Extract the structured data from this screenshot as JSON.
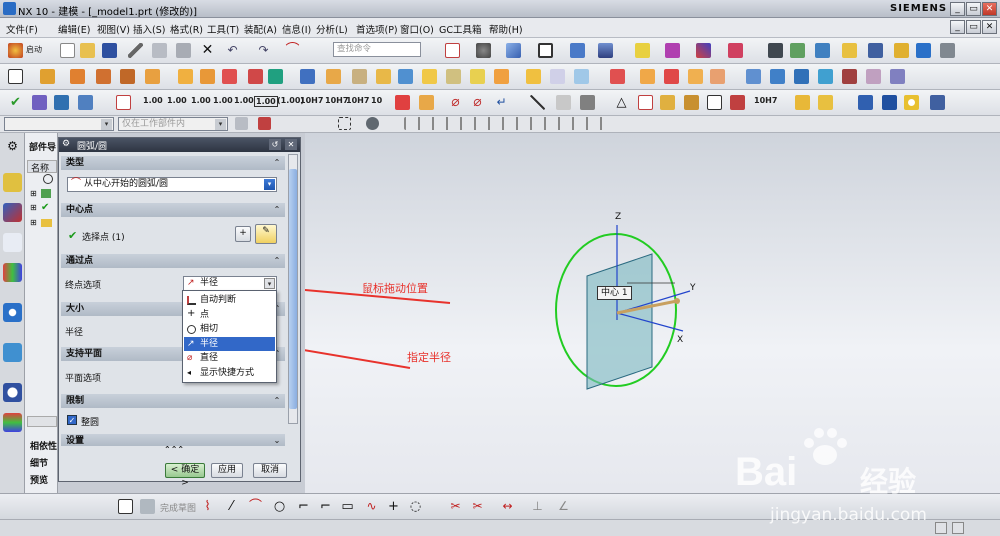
{
  "window": {
    "title": "NX 10 - 建模 - [_model1.prt (修改的)]",
    "brand": "SIEMENS",
    "controls": [
      "_",
      "▭",
      "✕"
    ]
  },
  "menu": {
    "items": [
      "文件(F)",
      "编辑(E)",
      "视图(V)",
      "插入(S)",
      "格式(R)",
      "工具(T)",
      "装配(A)",
      "信息(I)",
      "分析(L)",
      "首选项(P)",
      "窗口(O)",
      "GC工具箱",
      "帮助(H)"
    ],
    "start_label": "启动",
    "search_placeholder": "查找命令"
  },
  "toolbar3": {
    "labels": [
      "1.00",
      "1.00",
      "1.00",
      "1.00",
      "1.00",
      "1.00",
      "(1.00)",
      "10H7",
      "10H7",
      "10H7",
      "10",
      "10H7"
    ]
  },
  "toolbar4": {
    "filter_placeholder": "仅在工作部件内"
  },
  "nav": {
    "tab_label": "部件导",
    "col_name": "名称",
    "bottom_labels": [
      "相依性",
      "细节",
      "预览"
    ]
  },
  "dialog": {
    "title": "圆弧/圆",
    "type_section": "类型",
    "type_value": "从中心开始的圆弧/圆",
    "center_section": "中心点",
    "center_row": "选择点 (1)",
    "through_section": "通过点",
    "end_option_label": "终点选项",
    "end_option_value": "半径",
    "size_section": "大小",
    "radius_label": "半径",
    "plane_section": "支持平面",
    "plane_option_label": "平面选项",
    "limit_section": "限制",
    "full_circle_label": "整圆",
    "settings_section": "设置",
    "ok_label": "< 确定 >",
    "apply_label": "应用",
    "cancel_label": "取消"
  },
  "dropdown": {
    "options": [
      "自动判断",
      "点",
      "相切",
      "半径",
      "直径",
      "显示快捷方式"
    ],
    "highlighted": "半径"
  },
  "viewport": {
    "label_center": "中心 1",
    "axis_x": "X",
    "axis_y": "Y",
    "axis_z": "Z",
    "annotation_1": "鼠标拖动位置",
    "annotation_2": "指定半径"
  },
  "bottombar": {
    "finish_sketch": "完成草图"
  },
  "watermark": {
    "brand": "Bai",
    "brand_cn": "经验",
    "url": "jingyan.baidu.com"
  },
  "colors": {
    "accent": "#3268c8",
    "circle": "#22cc22",
    "plane": "#7ab8c0",
    "arrow": "#e8322c",
    "csys_axis": "#2244cc"
  }
}
